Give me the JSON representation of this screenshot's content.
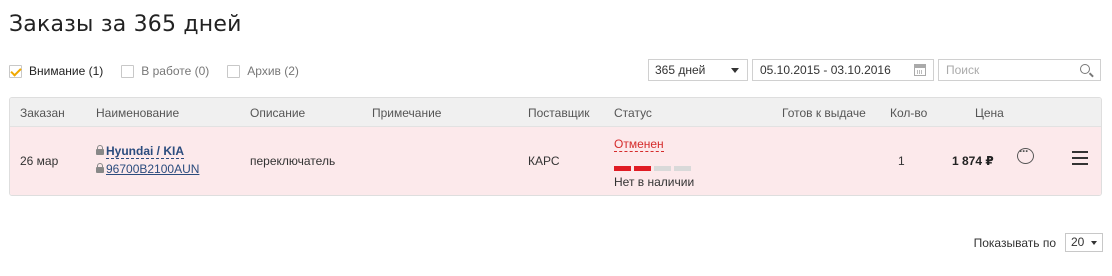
{
  "page": {
    "title": "Заказы за 365 дней"
  },
  "filters": [
    {
      "label": "Внимание (1)",
      "checked": true
    },
    {
      "label": "В работе (0)",
      "checked": false
    },
    {
      "label": "Архив (2)",
      "checked": false
    }
  ],
  "toolbar": {
    "period": "365 дней",
    "date_range": "05.10.2015 - 03.10.2016",
    "search_placeholder": "Поиск"
  },
  "table": {
    "headers": {
      "ordered": "Заказан",
      "name": "Наименование",
      "description": "Описание",
      "note": "Примечание",
      "supplier": "Поставщик",
      "status": "Статус",
      "ready": "Готов к выдаче",
      "qty": "Кол-во",
      "price": "Цена"
    },
    "rows": [
      {
        "date": "26 мар",
        "brand": "Hyundai / KIA",
        "article": "96700B2100AUN",
        "description": "переключатель",
        "note": "",
        "supplier": "КАРС",
        "status": "Отменен",
        "status_progress": "2 of 4",
        "availability": "Нет в наличии",
        "ready": "",
        "qty": "1",
        "price": "1 874 ₽"
      }
    ]
  },
  "colors": {
    "row_background": "#fce9eb",
    "status_red": "#d52b2b",
    "link_blue": "#2b4c7e",
    "check_orange": "#f0a800"
  },
  "icons": [
    "calendar-icon",
    "search-icon",
    "lock-icon",
    "comment-icon",
    "menu-icon",
    "chevron-down-icon"
  ],
  "pager": {
    "label": "Показывать по",
    "value": "20"
  }
}
